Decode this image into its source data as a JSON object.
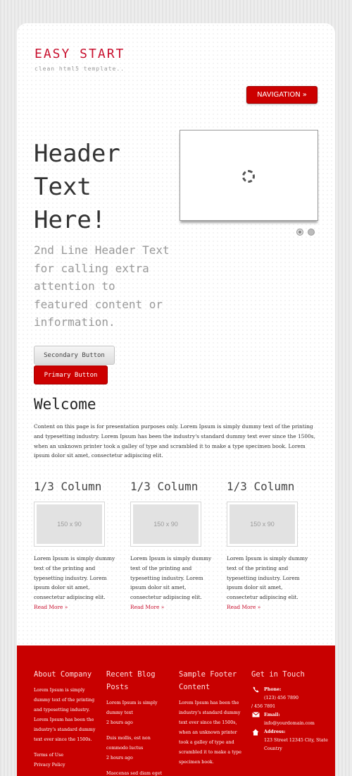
{
  "header": {
    "logo": "EASY START",
    "tagline": "clean html5 template..",
    "nav_label": "NAVIGATION",
    "nav_arrow": "»"
  },
  "hero": {
    "title": "Header Text Here!",
    "subtitle": "2nd Line Header Text for calling extra attention to featured content or information.",
    "secondary_button": "Secondary Button",
    "primary_button": "Primary Button"
  },
  "welcome": {
    "title": "Welcome",
    "text": "Content on this page is for presentation purposes only. Lorem Ipsum is simply dummy text of the printing and typesetting industry. Lorem Ipsum has been the industry's standard dummy text ever since the 1500s, when an unknown printer took a galley of type and scrambled it to make a type specimen book. Lorem ipsum dolor sit amet, consectetur adipiscing elit."
  },
  "columns": [
    {
      "title": "1/3 Column",
      "image": "150 x 90",
      "text": "Lorem Ipsum is simply dummy text of the printing and typesetting industry. Lorem ipsum dolor sit amet, consectetur adipiscing elit.",
      "link": "Read More »"
    },
    {
      "title": "1/3 Column",
      "image": "150 x 90",
      "text": "Lorem Ipsum is simply dummy text of the printing and typesetting industry. Lorem ipsum dolor sit amet, consectetur adipiscing elit.",
      "link": "Read More »"
    },
    {
      "title": "1/3 Column",
      "image": "150 x 90",
      "text": "Lorem Ipsum is simply dummy text of the printing and typesetting industry. Lorem ipsum dolor sit amet, consectetur adipiscing elit.",
      "link": "Read More »"
    }
  ],
  "footer": {
    "about": {
      "title": "About Company",
      "text": "Lorem Ipsum is simply dummy text of the printing and typesetting industry. Lorem Ipsum has been the industry's standard dummy text ever since the 1500s.",
      "links": [
        "Terms of Use",
        "Privacy Policy"
      ]
    },
    "blog": {
      "title": "Recent Blog Posts",
      "posts": [
        {
          "text": "Lorem Ipsum is simply dummy text",
          "time": "2 hours ago"
        },
        {
          "text": "Duis mollis, est non commodo luctus",
          "time": "2 hours ago"
        },
        {
          "text": "Maecenas sed diam eget",
          "time": ""
        }
      ]
    },
    "sample": {
      "title": "Sample Footer Content",
      "text": "Lorem Ipsum has been the industry's standard dummy text ever since the 1500s, when an unknown printer took a galley of type and scrambled it to make a type specimen book."
    },
    "contact": {
      "title": "Get in Touch",
      "phone_label": "Phone:",
      "phone_1": "(123) 456 7890",
      "phone_2": "/ 456 7891",
      "email_label": "Email:",
      "email": "info@yourdomain.com",
      "address_label": "Address:",
      "address": "123 Street 12345 City, State Country"
    }
  },
  "colors": {
    "accent": "#c8102e",
    "footer_bg": "#c80000"
  }
}
